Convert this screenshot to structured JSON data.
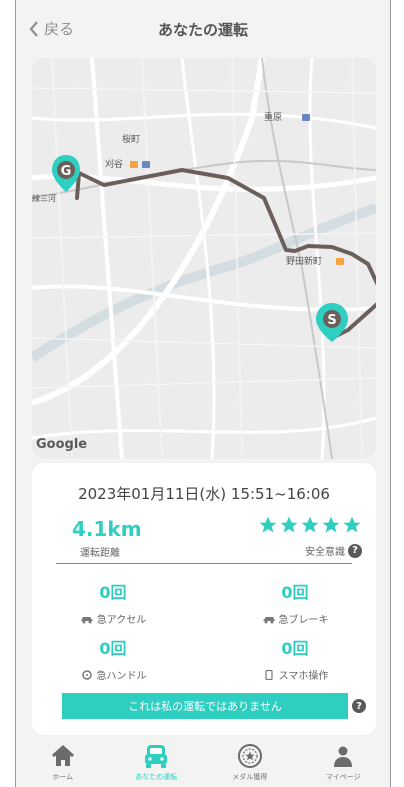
{
  "header": {
    "back_label": "戻る",
    "title": "あなたの運転"
  },
  "map": {
    "labels": {
      "kariya": "刈谷",
      "kuwamachi": "桜町",
      "shigehara": "重原",
      "nodashinmachi": "野田新町",
      "higashimikawa": "線三河",
      "google": "Google"
    },
    "goal_marker": "G",
    "start_marker": "S"
  },
  "summary": {
    "date": "2023年01月11日(水) 15:51~16:06",
    "distance": "4.1km",
    "distance_label": "運転距離",
    "safety_rating": 5,
    "safety_label": "安全意識",
    "help": "?"
  },
  "stats": {
    "accel": {
      "value": "0回",
      "label": "急アクセル"
    },
    "brake": {
      "value": "0回",
      "label": "急ブレーキ"
    },
    "steer": {
      "value": "0回",
      "label": "急ハンドル"
    },
    "phone": {
      "value": "0回",
      "label": "スマホ操作"
    }
  },
  "report_button": "これは私の運転ではありません",
  "nav": [
    {
      "label": "ホーム",
      "icon": "home-icon"
    },
    {
      "label": "あなたの運転",
      "icon": "car-icon"
    },
    {
      "label": "メダル獲得",
      "icon": "medal-icon"
    },
    {
      "label": "マイページ",
      "icon": "user-icon"
    }
  ],
  "colors": {
    "accent": "#2ecfc1",
    "route": "#6b5f5c",
    "star": "#2ecfc1"
  }
}
